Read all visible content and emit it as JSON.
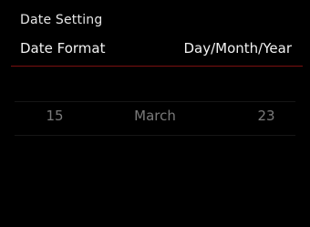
{
  "header": {
    "title": "Date Setting"
  },
  "setting": {
    "label": "Date Format",
    "value": "Day/Month/Year"
  },
  "picker": {
    "day": "15",
    "month": "March",
    "year": "23"
  },
  "colors": {
    "background": "#000000",
    "divider_accent": "#7a1010",
    "text_primary": "#f2f2f2",
    "text_muted": "#7a7a7a"
  }
}
